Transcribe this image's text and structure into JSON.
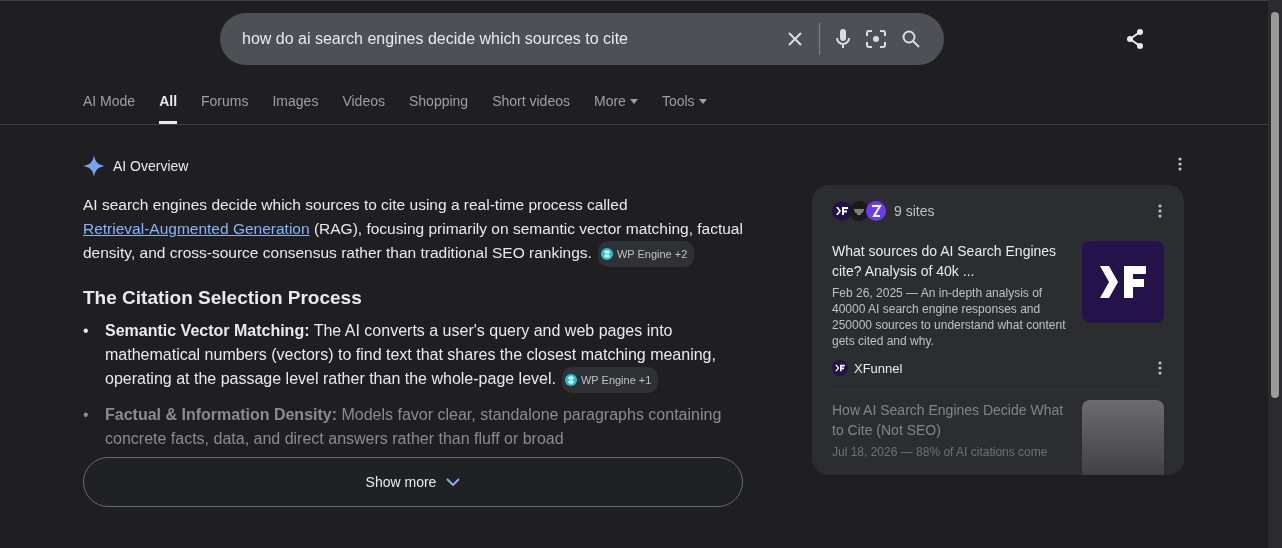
{
  "search": {
    "value": "how do ai search engines decide which sources to cite"
  },
  "tabs": [
    {
      "label": "AI Mode",
      "selected": false,
      "kind": "link"
    },
    {
      "label": "All",
      "selected": true,
      "kind": "link"
    },
    {
      "label": "Forums",
      "selected": false,
      "kind": "link"
    },
    {
      "label": "Images",
      "selected": false,
      "kind": "link"
    },
    {
      "label": "Videos",
      "selected": false,
      "kind": "link"
    },
    {
      "label": "Shopping",
      "selected": false,
      "kind": "link"
    },
    {
      "label": "Short videos",
      "selected": false,
      "kind": "link"
    },
    {
      "label": "More",
      "selected": false,
      "kind": "menu"
    },
    {
      "label": "Tools",
      "selected": false,
      "kind": "menu"
    }
  ],
  "overview": {
    "title": "AI Overview",
    "intro": {
      "before": "AI search engines decide which sources to cite  using a real-time process called ",
      "link": "Retrieval-Augmented Generation",
      "after": " (RAG), focusing primarily on semantic vector matching, factual density, and cross-source consensus rather than traditional SEO rankings.",
      "chip": "WP Engine +2"
    },
    "heading": "The Citation Selection Process",
    "bullets": [
      {
        "marker": "•",
        "term": "Semantic Vector Matching:",
        "text": " The AI converts a user's query and web pages into mathematical numbers (vectors) to find text that shares the closest matching meaning, operating at the passage level rather than the whole-page level.",
        "chip": "WP Engine +1",
        "faded": false
      },
      {
        "marker": "•",
        "term": "Factual & Information Density:",
        "text": " Models favor clear, standalone paragraphs containing concrete facts, data, and direct answers rather than fluff or broad",
        "faded": true
      }
    ],
    "show_more": "Show more"
  },
  "sources": {
    "count": "9 sites",
    "items": [
      {
        "title": "What sources do AI Search Engines cite? Analysis of 40k ...",
        "snippet": "Feb 26, 2025 — An in-depth analysis of 40000 AI search engine responses and 250000 sources to understand what content gets cited and why.",
        "site": "XFunnel",
        "faded": false
      },
      {
        "title": "How AI Search Engines Decide What to Cite (Not SEO)",
        "snippet": "Jul 18, 2026 — 88% of AI citations come",
        "faded": true
      }
    ]
  }
}
